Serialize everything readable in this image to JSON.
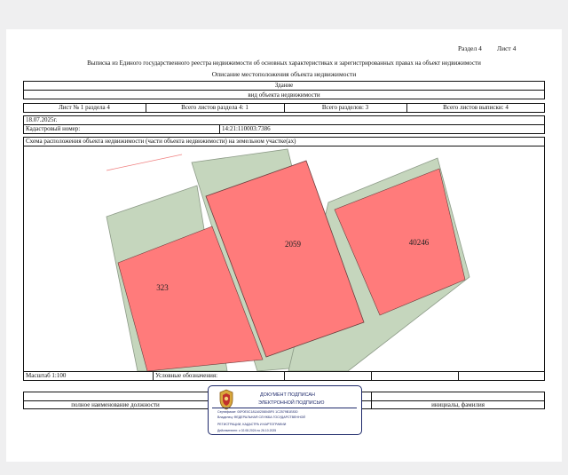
{
  "header": {
    "section": "Раздел 4",
    "sheet": "Лист 4",
    "title": "Выписка из Единого государственного реестра недвижимости об основных характеристиках и зарегистрированных правах на объект недвижимости",
    "subtitle": "Описание местоположения объекта недвижимости"
  },
  "object": {
    "kind": "Здание",
    "kind_caption": "вид объекта недвижимости"
  },
  "sheet_info": {
    "sheet_no": "Лист № 1 раздела 4",
    "total_section_sheets": "Всего листов раздела 4: 1",
    "total_sections": "Всего разделов: 3",
    "total_extract_sheets": "Всего листов выписки: 4"
  },
  "date": "18.07.2025г.",
  "cadastral_label": "Кадастровый номер:",
  "cadastral_number": "14:21:110003:7386",
  "scheme_title": "Схема расположения объекта недвижимости (части объекта недвижимости) на земельном участке(ах)",
  "parcels": [
    "323",
    "2059",
    "40246"
  ],
  "scale": "Масштаб 1:100",
  "legend_label": "Условные обозначения:",
  "signature": {
    "position_caption": "полное наименование должности",
    "name_caption": "инициалы, фамилия"
  },
  "stamp": {
    "line1": "ДОКУМЕНТ ПОДПИСАН",
    "line2": "ЭЛЕКТРОННОЙ ПОДПИСЬЮ",
    "certificate": "Сертификат: 00F0E0C181A0208045F0 1C2579B1E830",
    "owner1": "Владелец: ФЕДЕРАЛЬНАЯ СЛУЖБА ГОСУДАРСТВЕННОЙ",
    "owner2": "РЕГИСТРАЦИИ, КАДАСТРА И КАРТОГРАФИИ",
    "validity": "Действителен: с 02.08.2024 по 26.10.2025"
  },
  "colors": {
    "parcel_fill": "#ff7b7b",
    "land_fill": "#c5d6bd",
    "land_border": "#8c9a87",
    "stamp_blue": "#1f2a6b"
  }
}
